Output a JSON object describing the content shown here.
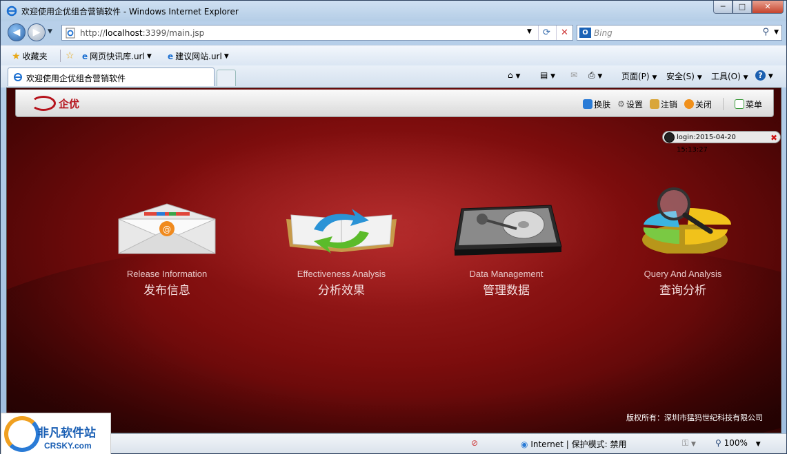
{
  "window": {
    "title": "欢迎使用企优组合营销软件 - Windows Internet Explorer",
    "minimize": "─",
    "maximize": "□",
    "close": "✕"
  },
  "address": {
    "url_prefix": "http://",
    "url_host": "localhost",
    "url_rest": ":3399/main.jsp"
  },
  "search": {
    "placeholder": "Bing"
  },
  "favorites": {
    "label": "收藏夹",
    "items": [
      {
        "label": "网页快讯库.url"
      },
      {
        "label": "建议网站.url"
      }
    ]
  },
  "tabs": [
    {
      "label": "欢迎使用企优组合营销软件"
    }
  ],
  "command_bar": {
    "page": "页面(P)",
    "safety": "安全(S)",
    "tools": "工具(O)"
  },
  "app": {
    "logo_text": "企优",
    "toolbar": {
      "skin": "换肤",
      "settings": "设置",
      "logout": "注销",
      "close": "关闭",
      "menu": "菜单"
    },
    "login_text": "login:2015-04-20 15:13:27",
    "modules": [
      {
        "en": "Release Information",
        "zh": "发布信息",
        "icon": "envelope-icon"
      },
      {
        "en": "Effectiveness Analysis",
        "zh": "分析效果",
        "icon": "refresh-book-icon"
      },
      {
        "en": "Data Management",
        "zh": "管理数据",
        "icon": "hard-drive-icon"
      },
      {
        "en": "Query And Analysis",
        "zh": "查询分析",
        "icon": "pie-chart-magnifier-icon"
      }
    ],
    "copyright": "版权所有：深圳市猛犸世纪科技有限公司"
  },
  "status": {
    "zone": "Internet | 保护模式: 禁用",
    "zoom": "100%"
  },
  "watermark": {
    "zh": "非凡软件站",
    "en": "CRSKY.com"
  }
}
